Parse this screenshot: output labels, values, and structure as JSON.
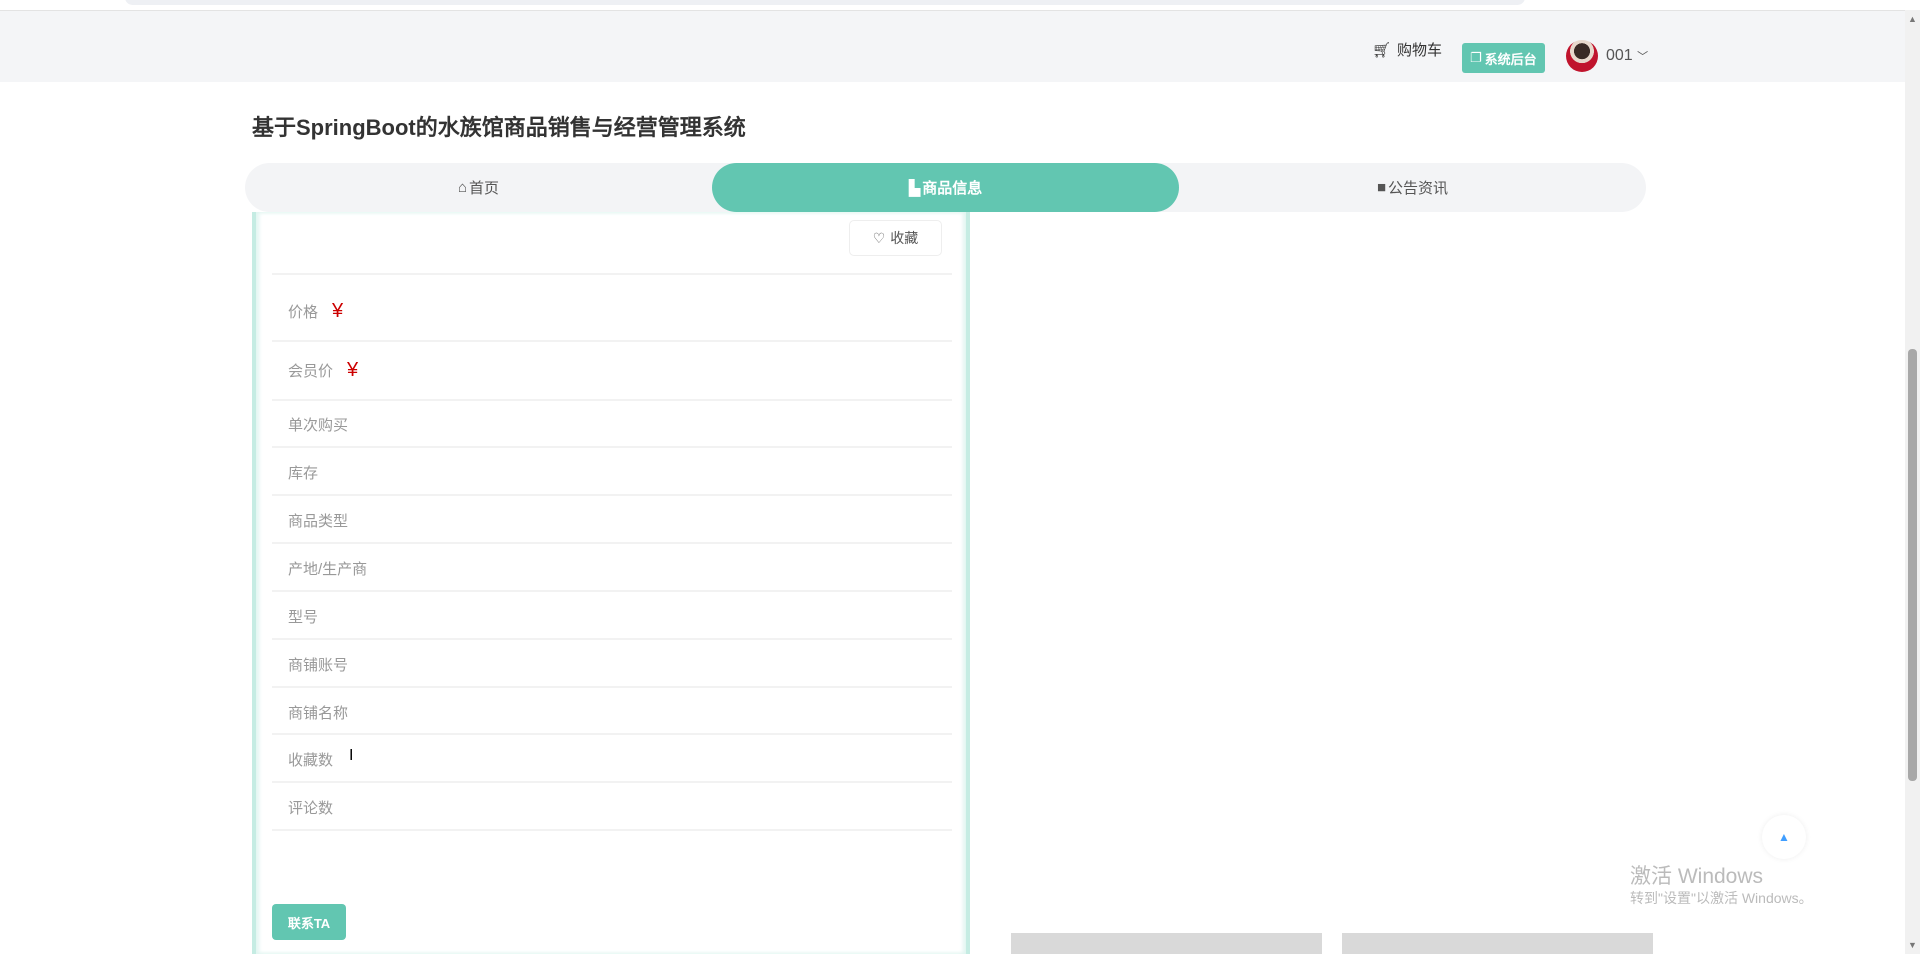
{
  "header": {
    "cart_label": "购物车",
    "admin_label": "系统后台",
    "username": "001"
  },
  "page_title": "基于SpringBoot的水族馆商品销售与经营管理系统",
  "tabs": [
    {
      "label": "首页",
      "active": false
    },
    {
      "label": "商品信息",
      "active": true
    },
    {
      "label": "公告资讯",
      "active": false
    }
  ],
  "product": {
    "favorite_label": "收藏",
    "price_label": "价格",
    "price_symbol": "¥",
    "member_price_label": "会员价",
    "member_price_symbol": "¥",
    "fields": [
      "单次购买",
      "库存",
      "商品类型",
      "产地/生产商",
      "型号",
      "商铺账号",
      "商铺名称",
      "收藏数",
      "评论数"
    ],
    "contact_label": "联系TA"
  },
  "watermark": {
    "line1": "激活 Windows",
    "line2": "转到\"设置\"以激活 Windows。"
  },
  "colors": {
    "accent": "#62c6b1",
    "price": "#cc0000"
  }
}
